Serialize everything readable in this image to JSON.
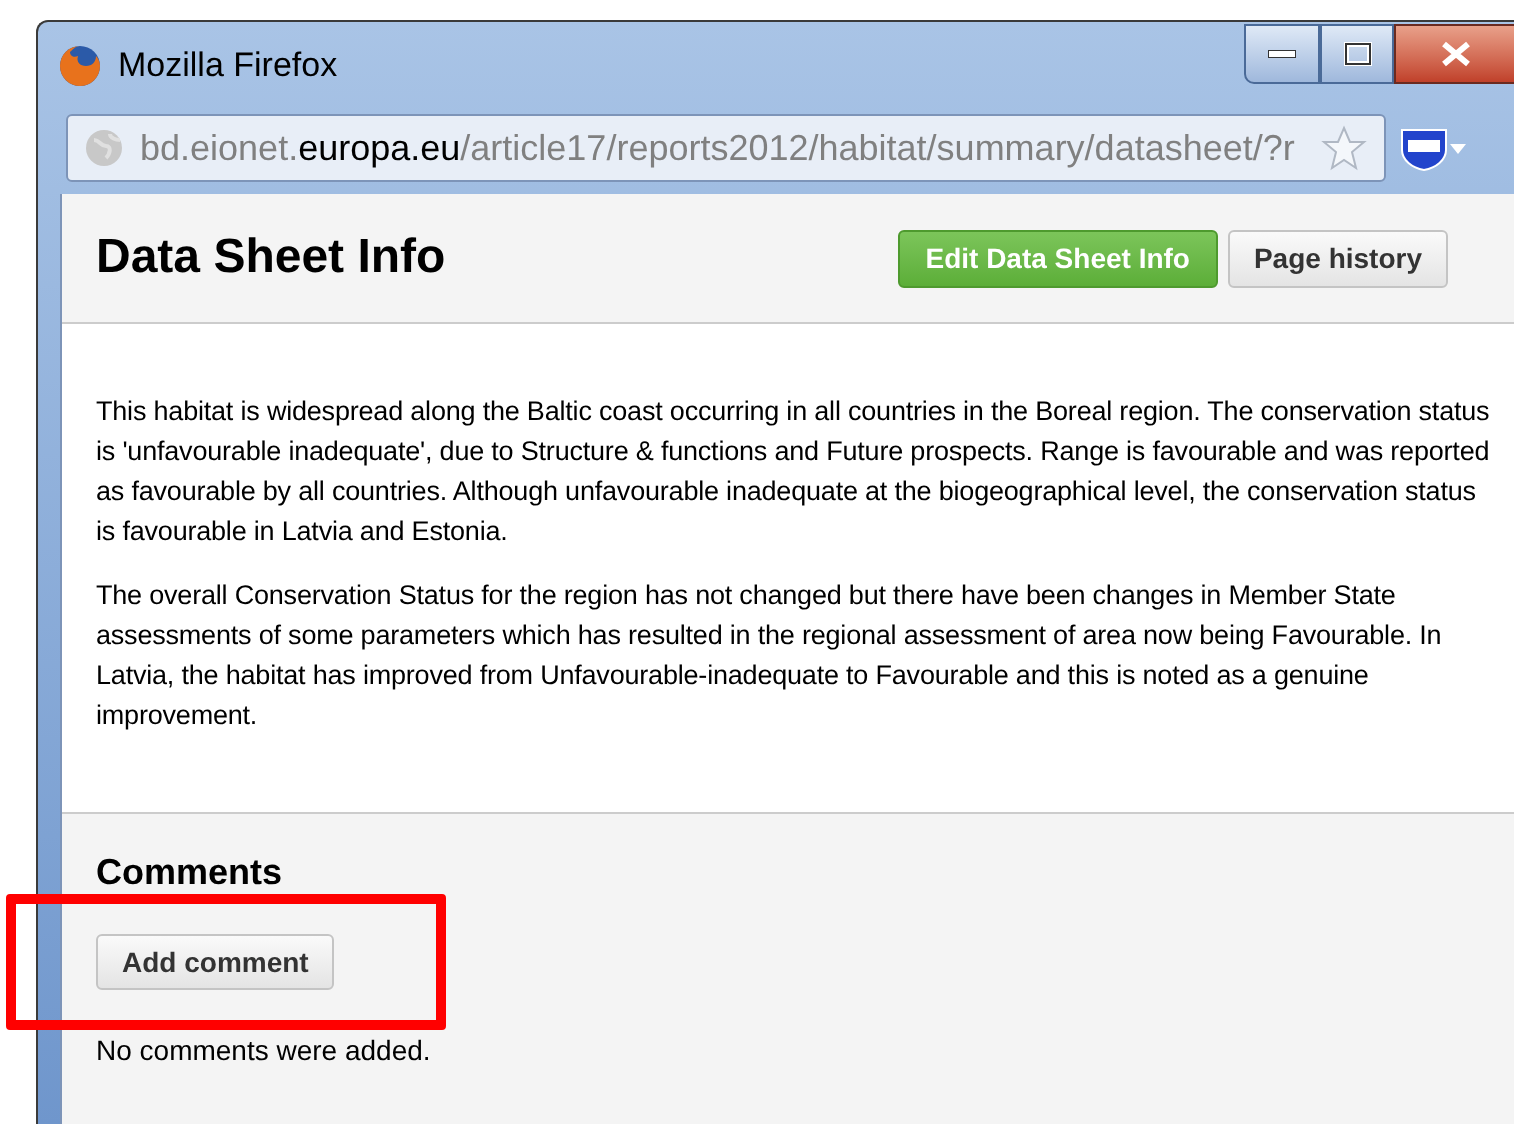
{
  "window": {
    "title": "Mozilla Firefox"
  },
  "address_bar": {
    "subdomain": "bd.eionet.",
    "domain": "europa.eu",
    "path": "/article17/reports2012/habitat/summary/datasheet/?r"
  },
  "page": {
    "title": "Data Sheet Info",
    "buttons": [
      {
        "label": "Edit Data Sheet Info",
        "kind": "primary"
      },
      {
        "label": "Page history",
        "kind": "secondary"
      }
    ],
    "paragraphs": [
      "This habitat is widespread along the Baltic coast occurring in all countries in the Boreal region. The conservation status is 'unfavourable inadequate', due to Structure & functions and Future prospects. Range is favourable and was reported as favourable by all countries. Although unfavourable inadequate at the biogeographical level, the conservation status is favourable in Latvia and Estonia.",
      "The overall Conservation Status for the region has not changed but there have been changes in Member State assessments of some parameters which has resulted in the regional assessment of area now being Favourable. In Latvia, the habitat has improved from Unfavourable-inadequate to Favourable and this is noted as a genuine improvement."
    ]
  },
  "comments": {
    "heading": "Comments",
    "button": "Add comment",
    "empty_message": "No comments were added."
  }
}
